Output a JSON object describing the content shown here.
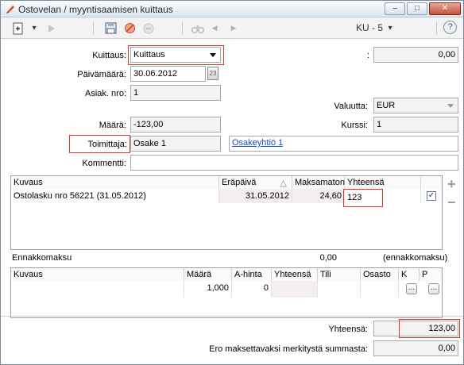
{
  "window": {
    "title": "Ostovelan / myyntisaamisen kuittaus",
    "min": "–",
    "max": "□",
    "close": "✕"
  },
  "toolbar": {
    "new_icon": "new-document-icon",
    "dropdown_arrow": "▾",
    "forward_icon": "forward-icon",
    "save_icon": "save-icon",
    "cancel_icon": "cancel-icon",
    "remove_icon": "remove-icon",
    "binoculars_icon": "binoculars-icon",
    "prev": "◀",
    "next": "▶",
    "record_label": "KU - 5",
    "record_arrow": "▾",
    "help": "?"
  },
  "form": {
    "kuittaus_label": "Kuittaus:",
    "kuittaus_value": "Kuittaus",
    "colon_label": ":",
    "top_amount": "0,00",
    "paivamaara_label": "Päivämäärä:",
    "paivamaara_value": "30.06.2012",
    "calendar_text": "23",
    "asiak_label": "Asiak. nro:",
    "asiak_value": "1",
    "valuutta_label": "Valuutta:",
    "valuutta_value": "EUR",
    "maara_label": "Määrä:",
    "maara_value": "-123,00",
    "kurssi_label": "Kurssi:",
    "kurssi_value": "1",
    "toimittaja_label": "Toimittaja:",
    "toimittaja_value": "Osake 1",
    "toimittaja_link": "Osakeyhtiö 1",
    "kommentti_label": "Kommentti:",
    "kommentti_value": ""
  },
  "invoices": {
    "headers": [
      "Kuvaus",
      "Eräpäivä",
      "Maksamaton",
      "Yhteensä"
    ],
    "sort_indicator": "△",
    "rows": [
      {
        "kuvaus": "Ostolasku nro 56221 (31.05.2012)",
        "erapaiva": "31.05.2012",
        "maksamaton": "24,60",
        "yhteensa": "123",
        "checked": "✓"
      }
    ],
    "add": "+",
    "remove": "−"
  },
  "advance": {
    "label": "Ennakkomaksu",
    "value": "0,00",
    "note": "(ennakkomaksu)"
  },
  "lines": {
    "headers": [
      "Kuvaus",
      "Määrä",
      "A-hinta",
      "Yhteensä",
      "Tili",
      "Osasto",
      "K",
      "P"
    ],
    "rows": [
      {
        "kuvaus": "",
        "maara": "1,000",
        "ahinta": "0",
        "yhteensa": "",
        "tili": "",
        "osasto": "",
        "k": "…",
        "p": "…"
      }
    ]
  },
  "totals": {
    "yhteensa_label": "Yhteensä:",
    "yhteensa_value": "123,00",
    "ero_label": "Ero maksettavaksi merkitystä summasta:",
    "ero_value": "0,00"
  },
  "colors": {
    "highlight": "#d9363a",
    "link": "#1a4fbf"
  }
}
